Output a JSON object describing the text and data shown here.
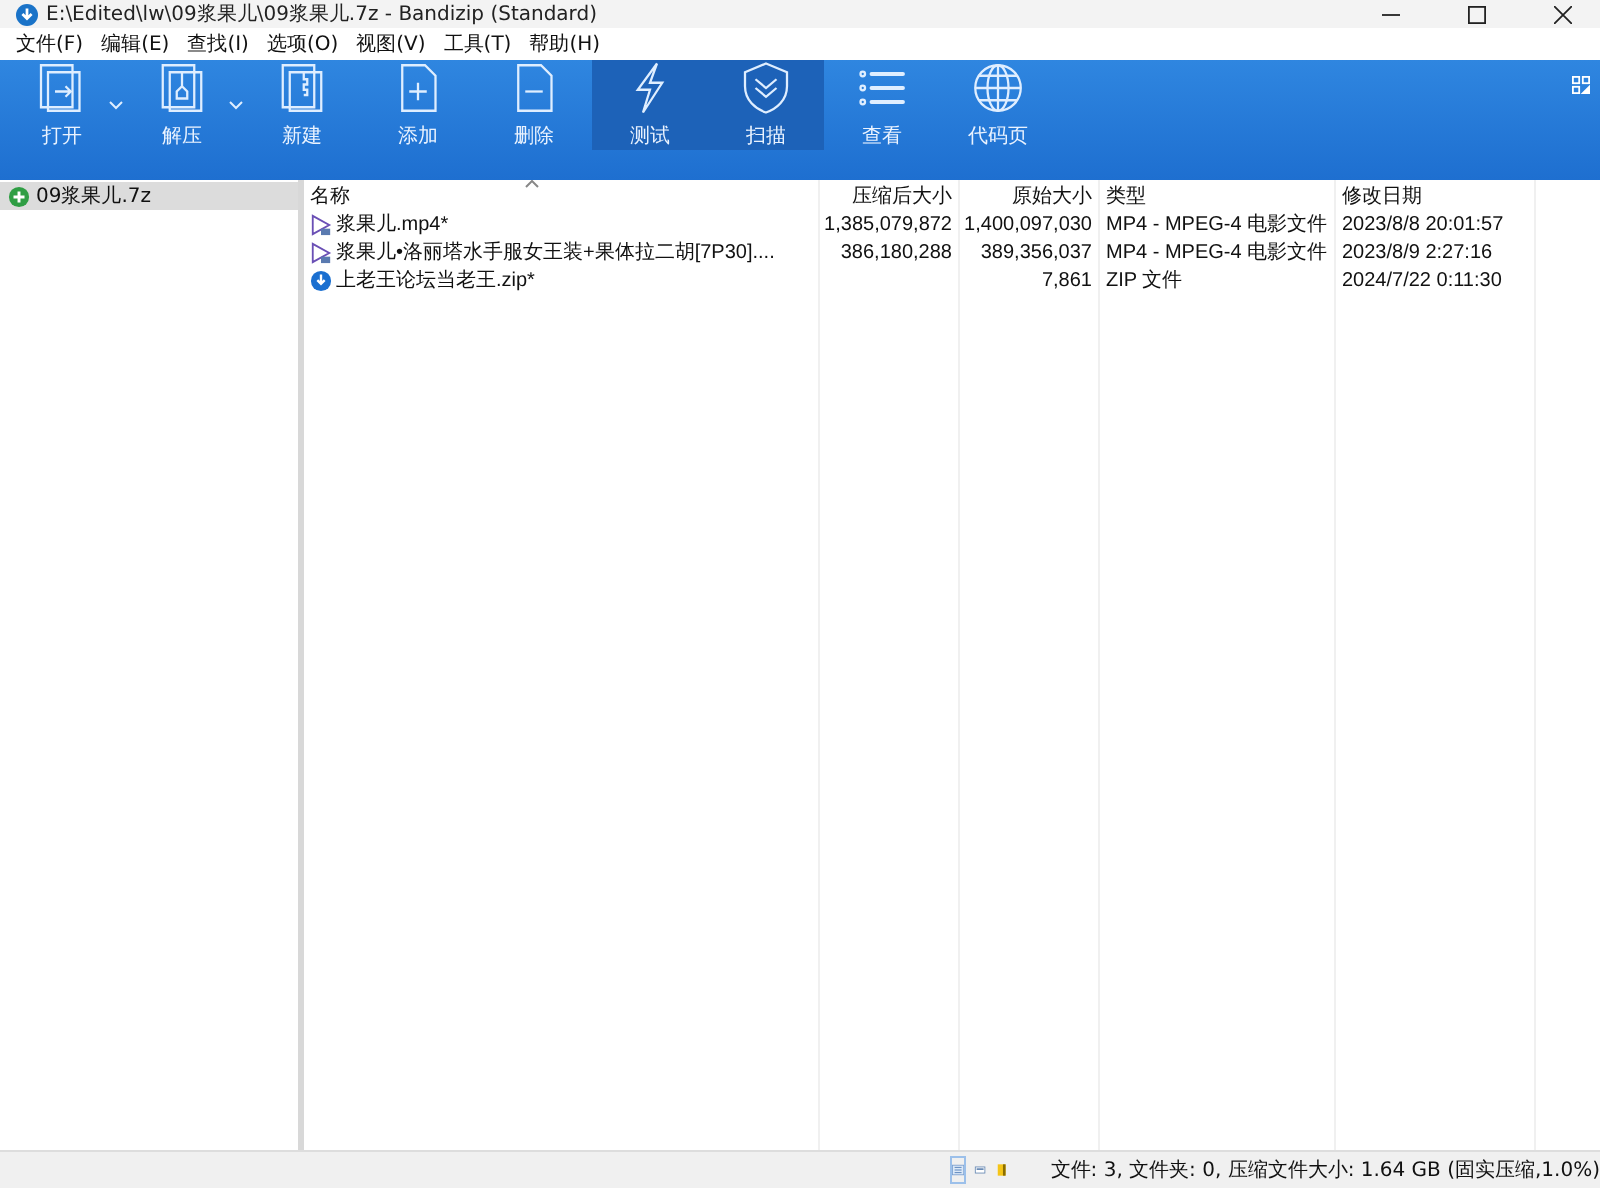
{
  "window": {
    "title": "E:\\Edited\\lw\\09浆果儿\\09浆果儿.7z - Bandizip (Standard)"
  },
  "menu": [
    "文件(F)",
    "编辑(E)",
    "查找(I)",
    "选项(O)",
    "视图(V)",
    "工具(T)",
    "帮助(H)"
  ],
  "toolbar": [
    {
      "label": "打开",
      "kind": "open",
      "dropdown": true,
      "selected": false
    },
    {
      "label": "解压",
      "kind": "extract",
      "dropdown": true,
      "selected": false
    },
    {
      "label": "新建",
      "kind": "new",
      "dropdown": false,
      "selected": false
    },
    {
      "label": "添加",
      "kind": "add",
      "dropdown": false,
      "selected": false
    },
    {
      "label": "删除",
      "kind": "delete",
      "dropdown": false,
      "selected": false
    },
    {
      "label": "测试",
      "kind": "test",
      "dropdown": false,
      "selected": true
    },
    {
      "label": "扫描",
      "kind": "scan",
      "dropdown": false,
      "selected": true
    },
    {
      "label": "查看",
      "kind": "view",
      "dropdown": false,
      "selected": false
    },
    {
      "label": "代码页",
      "kind": "codepage",
      "dropdown": false,
      "selected": false
    }
  ],
  "sidebar": {
    "items": [
      {
        "label": "09浆果儿.7z",
        "selected": true
      }
    ]
  },
  "table": {
    "columns": [
      "名称",
      "压缩后大小",
      "原始大小",
      "类型",
      "修改日期"
    ],
    "rows": [
      {
        "kind": "video",
        "cells": [
          "浆果儿.mp4*",
          "1,385,079,872",
          "1,400,097,030",
          "MP4 - MPEG-4 电影文件",
          "2023/8/8 20:01:57"
        ]
      },
      {
        "kind": "video",
        "cells": [
          "浆果儿•洛丽塔水手服女王装+果体拉二胡[7P30]....",
          "386,180,288",
          "389,356,037",
          "MP4 - MPEG-4 电影文件",
          "2023/8/9 2:27:16"
        ]
      },
      {
        "kind": "zip",
        "cells": [
          "上老王论坛当老王.zip*",
          "",
          "7,861",
          "ZIP 文件",
          "2024/7/22 0:11:30"
        ]
      }
    ]
  },
  "status_bar": {
    "text": "文件: 3, 文件夹: 0, 压缩文件大小: 1.64 GB (固实压缩,1.0%)"
  }
}
